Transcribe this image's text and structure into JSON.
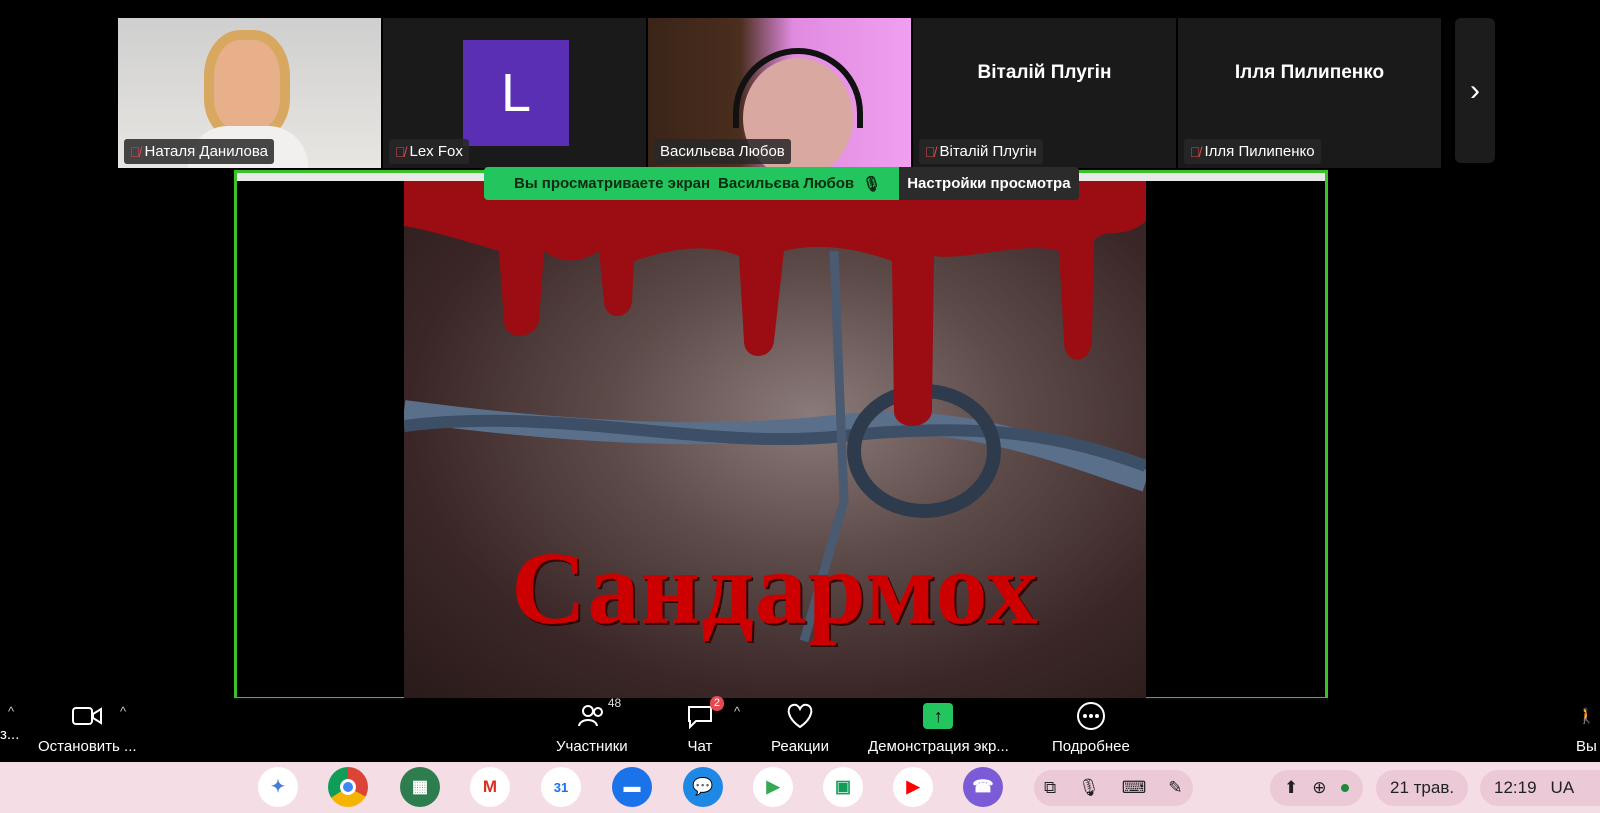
{
  "participants": [
    {
      "name": "Наталя Данилова",
      "muted": true
    },
    {
      "name": "Lex Fox",
      "avatar_letter": "L",
      "muted": true
    },
    {
      "name": "Васильєва Любов",
      "muted": false
    },
    {
      "name": "Віталій Плугін",
      "muted": true
    },
    {
      "name": "Ілля Пилипенко",
      "muted": true
    }
  ],
  "banner": {
    "viewing_label": "Вы просматриваете экран",
    "presenter": "Васильєва Любов",
    "settings": "Настройки просмотра"
  },
  "slide": {
    "title": "Сандармох"
  },
  "toolbar": {
    "left_cut": "з...",
    "stop_video": "Остановить ...",
    "participants": "Участники",
    "participants_count": "48",
    "chat": "Чат",
    "chat_badge": "2",
    "reactions": "Реакции",
    "share": "Демонстрация экр...",
    "more": "Подробнее",
    "leave_cut": "Вы"
  },
  "shelf": {
    "date": "21 трав.",
    "time": "12:19",
    "lang": "UA"
  },
  "colors": {
    "accent_green": "#22c55e",
    "share_border": "#39c22a",
    "blood": "#c00000"
  }
}
